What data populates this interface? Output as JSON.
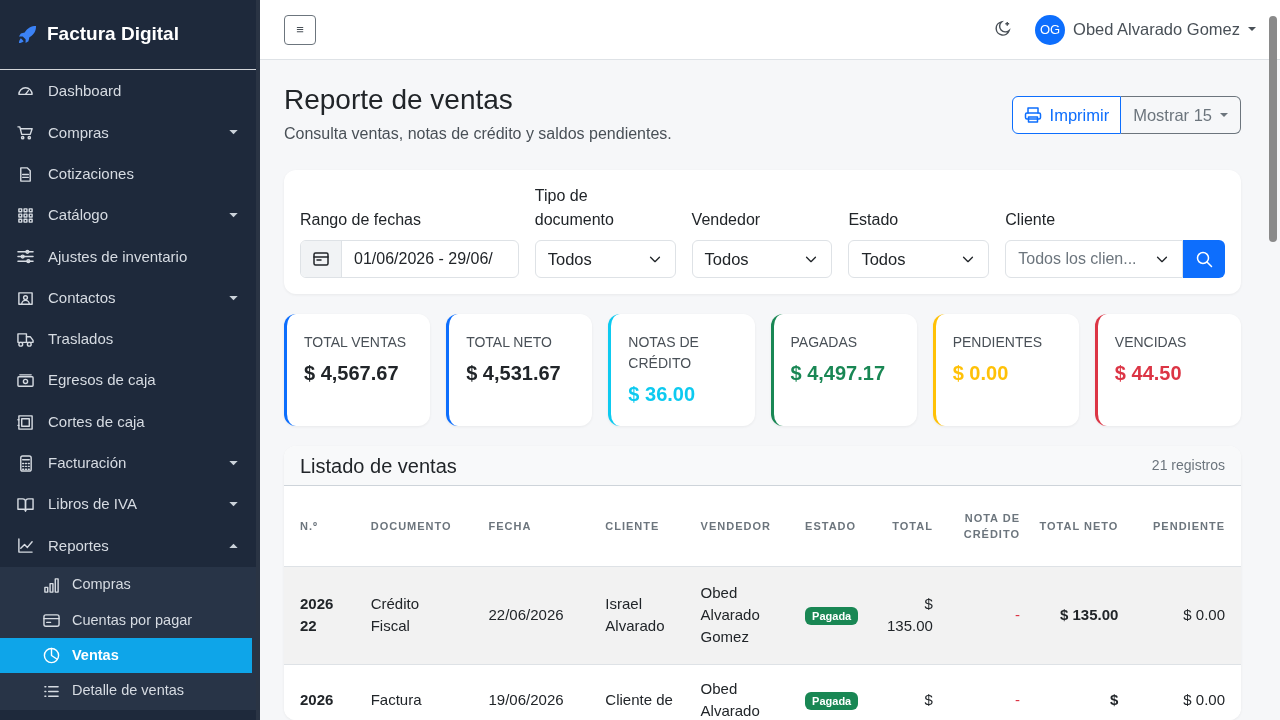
{
  "brand": "Factura Digital",
  "sidebar": {
    "items": [
      {
        "label": "Dashboard",
        "has_caret": false
      },
      {
        "label": "Compras",
        "has_caret": true,
        "expanded": false
      },
      {
        "label": "Cotizaciones",
        "has_caret": false
      },
      {
        "label": "Catálogo",
        "has_caret": true,
        "expanded": false
      },
      {
        "label": "Ajustes de inventario",
        "has_caret": false
      },
      {
        "label": "Contactos",
        "has_caret": true,
        "expanded": false
      },
      {
        "label": "Traslados",
        "has_caret": false
      },
      {
        "label": "Egresos de caja",
        "has_caret": false
      },
      {
        "label": "Cortes de caja",
        "has_caret": false
      },
      {
        "label": "Facturación",
        "has_caret": true,
        "expanded": false
      },
      {
        "label": "Libros de IVA",
        "has_caret": true,
        "expanded": false
      },
      {
        "label": "Reportes",
        "has_caret": true,
        "expanded": true,
        "children": [
          {
            "label": "Compras",
            "selected": false
          },
          {
            "label": "Cuentas por pagar",
            "selected": false
          },
          {
            "label": "Ventas",
            "selected": true
          },
          {
            "label": "Detalle de ventas",
            "selected": false
          }
        ]
      }
    ]
  },
  "header": {
    "menu_button": "≡",
    "user": {
      "initials": "OG",
      "name": "Obed Alvarado Gomez"
    }
  },
  "page": {
    "title": "Reporte de ventas",
    "subtitle": "Consulta ventas, notas de crédito y saldos pendientes.",
    "print_button": "Imprimir",
    "show_button": "Mostrar 15"
  },
  "filters": [
    {
      "kind": "date",
      "label": "Rango de fechas",
      "value": "01/06/2026 - 29/06/"
    },
    {
      "kind": "select",
      "label": "Tipo de documento",
      "value": "Todos"
    },
    {
      "kind": "select",
      "label": "Vendedor",
      "value": "Todos"
    },
    {
      "kind": "select",
      "label": "Estado",
      "value": "Todos"
    },
    {
      "kind": "search",
      "label": "Cliente",
      "placeholder": "Todos los clien..."
    }
  ],
  "stats": [
    {
      "label": "TOTAL VENTAS",
      "value": "$ 4,567.67",
      "color": "#0d6efd",
      "value_dark": true
    },
    {
      "label": "TOTAL NETO",
      "value": "$ 4,531.67",
      "color": "#0d6efd",
      "value_dark": true
    },
    {
      "label": "NOTAS DE CRÉDITO",
      "value": "$ 36.00",
      "color": "#0dcaf0",
      "value_dark": false
    },
    {
      "label": "PAGADAS",
      "value": "$ 4,497.17",
      "color": "#198754",
      "value_dark": false
    },
    {
      "label": "PENDIENTES",
      "value": "$ 0.00",
      "color": "#ffc107",
      "value_dark": false
    },
    {
      "label": "VENCIDAS",
      "value": "$ 44.50",
      "color": "#dc3545",
      "value_dark": false
    }
  ],
  "table": {
    "title": "Listado de ventas",
    "count": "21 registros",
    "columns": [
      "N.º",
      "DOCUMENTO",
      "FECHA",
      "CLIENTE",
      "VENDEDOR",
      "ESTADO",
      "TOTAL",
      "NOTA DE CRÉDITO",
      "TOTAL NETO",
      "PENDIENTE"
    ],
    "rows": [
      {
        "selected": true,
        "cells": [
          "202622",
          "Crédito Fiscal",
          "22/06/2026",
          "Israel Alvarado",
          "Obed Alvarado Gomez",
          "Pagada",
          "$ 135.00",
          "-",
          "$ 135.00",
          "$ 0.00"
        ]
      },
      {
        "selected": false,
        "cells": [
          "2026",
          "Factura",
          "19/06/2026",
          "Cliente de",
          "Obed Alvarado",
          "Pagada",
          "$",
          "-",
          "$",
          "$ 0.00"
        ]
      }
    ]
  }
}
